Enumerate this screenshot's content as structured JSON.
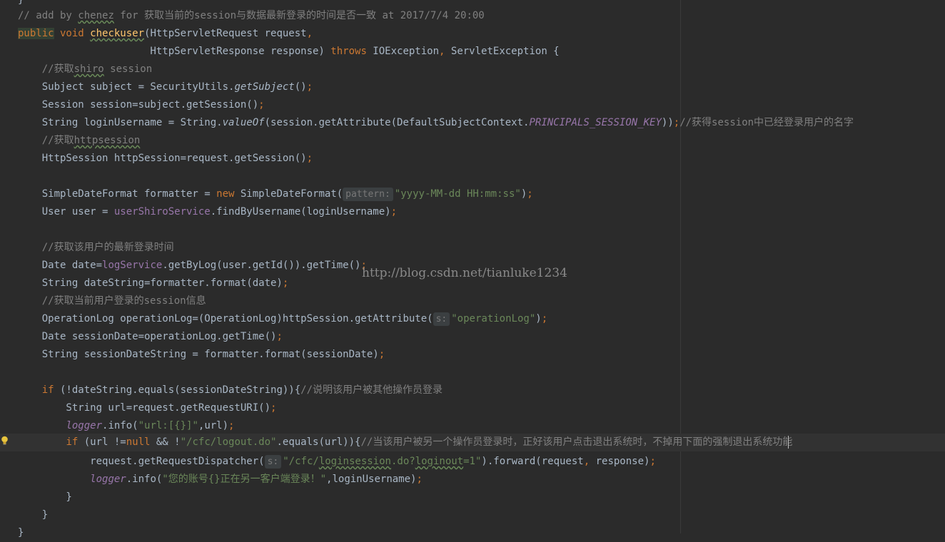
{
  "watermark": "http://blog.csdn.net/tianluke1234",
  "code": {
    "l0": {
      "a": "// add by ",
      "b": "chenez",
      "c": " for 获取当前的session与数据最新登录的时间是否一致 at 2017/7/4 20:00"
    },
    "l1": {
      "a": "public",
      "b": " void ",
      "c": "checkuser",
      "d": "(HttpServletRequest request",
      "e": ","
    },
    "l2": {
      "a": "                      HttpServletResponse response) ",
      "b": "throws",
      "c": " IOException",
      "d": ",",
      "e": " ServletException {"
    },
    "l3": {
      "a": "    //获取",
      "b": "shiro",
      "c": " session"
    },
    "l4": {
      "a": "    Subject subject = SecurityUtils.",
      "b": "getSubject",
      "c": "()",
      "d": ";"
    },
    "l5": {
      "a": "    Session session=subject.getSession()",
      "b": ";"
    },
    "l6": {
      "a": "    String loginUsername = String.",
      "b": "valueOf",
      "c": "(session.getAttribute(DefaultSubjectContext.",
      "d": "PRINCIPALS_SESSION_KEY",
      "e": "))",
      "f": ";",
      "g": "//获得session中已经登录用户的名字"
    },
    "l7": {
      "a": "    //获取",
      "b": "httpsession"
    },
    "l8": {
      "a": "    HttpSession httpSession=request.getSession()",
      "b": ";"
    },
    "l10": {
      "a": "    SimpleDateFormat formatter = ",
      "b": "new",
      "c": " SimpleDateFormat(",
      "hint": "pattern:",
      "d": "\"yyyy-MM-dd HH:mm:ss\"",
      "e": ")",
      "f": ";"
    },
    "l11": {
      "a": "    User user = ",
      "b": "userShiroService",
      "c": ".findByUsername(loginUsername)",
      "d": ";"
    },
    "l13": {
      "a": "    //获取该用户的最新登录时间"
    },
    "l14": {
      "a": "    Date date=",
      "b": "logService",
      "c": ".getByLog(user.getId()).getTime()",
      "d": ";"
    },
    "l15": {
      "a": "    String dateString=formatter.format(date)",
      "b": ";"
    },
    "l16": {
      "a": "    //获取当前用户登录的session信息"
    },
    "l17": {
      "a": "    OperationLog operationLog=(OperationLog)httpSession.getAttribute(",
      "hint": "s:",
      "b": "\"operationLog\"",
      "c": ")",
      "d": ";"
    },
    "l18": {
      "a": "    Date sessionDate=operationLog.getTime()",
      "b": ";"
    },
    "l19": {
      "a": "    String sessionDateString = formatter.format(sessionDate)",
      "b": ";"
    },
    "l21": {
      "a": "    ",
      "b": "if",
      "c": " (!dateString.equals(sessionDateString)){",
      "d": "//说明该用户被其他操作员登录"
    },
    "l22": {
      "a": "        String url=request.getRequestURI()",
      "b": ";"
    },
    "l23": {
      "a": "        ",
      "b": "logger",
      "c": ".info(",
      "d": "\"url:[{}]\"",
      "e": ",url)",
      "f": ";"
    },
    "l24": {
      "a": "        ",
      "b": "if",
      "c": " (url !=",
      "d": "null",
      "e": " && !",
      "f": "\"/cfc/logout.do\"",
      "g": ".equals(url)){",
      "h": "//当该用户被另一个操作员登录时，正好该用户点击退出系统时，不掉用下面的强制退出系统功能"
    },
    "l25": {
      "a": "            request.getRequestDispatcher(",
      "hint": "s:",
      "b": "\"/cfc/",
      "c": "loginsession",
      "d": ".do?",
      "e": "loginout",
      "f": "=1\"",
      "g": ").forward(request",
      "h": ",",
      "i": " response)",
      "j": ";"
    },
    "l26": {
      "a": "            ",
      "b": "logger",
      "c": ".info(",
      "d": "\"您的账号{}正在另一客户端登录！\"",
      "e": ",loginUsername)",
      "f": ";"
    },
    "l27": {
      "a": "        }"
    },
    "l28": {
      "a": "    }"
    },
    "l29": {
      "a": "}"
    }
  },
  "colors": {
    "background": "#2b2b2b",
    "keyword": "#cc7832",
    "comment": "#808080",
    "string": "#6a8759",
    "method": "#ffc66d",
    "field": "#9876aa",
    "text": "#a9b7c6"
  },
  "icons": {
    "gutter": "lightbulb-icon"
  }
}
